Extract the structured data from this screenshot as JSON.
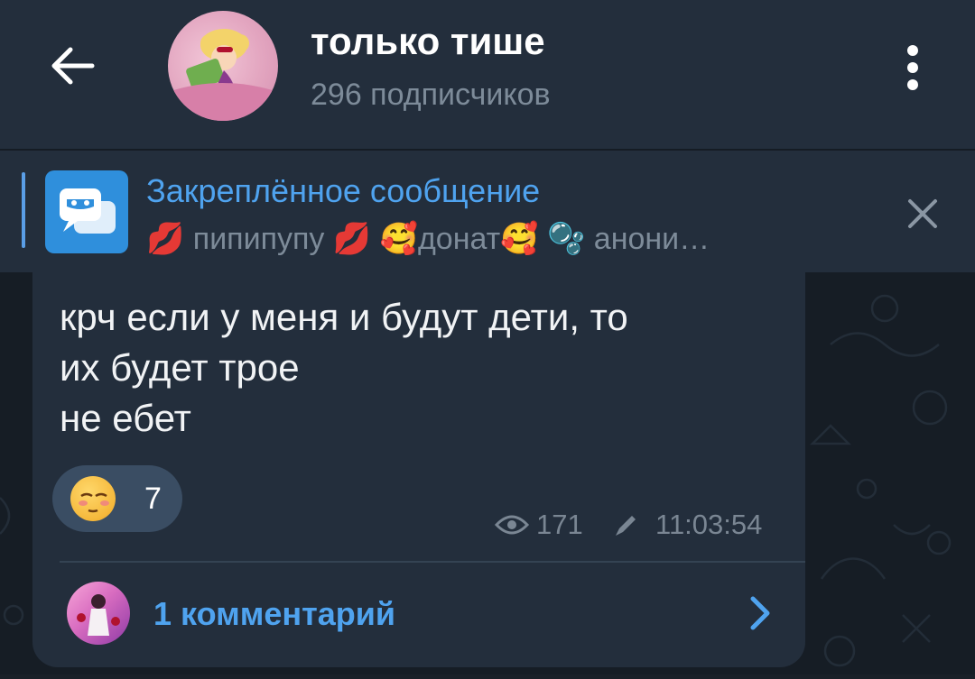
{
  "header": {
    "title": "только тише",
    "subtitle": "296 подписчиков",
    "back_icon": "arrow-left-icon",
    "menu_icon": "more-vertical-icon"
  },
  "pinned": {
    "title": "Закреплённое сообщение",
    "text": "💋 пипипупу 💋 🥰донат🥰 🫧 анони…",
    "close_icon": "close-icon"
  },
  "message": {
    "text": "крч если у меня и будут дети, то\nих будет трое\nне ебет",
    "reaction": {
      "emoji": "pensive-blush-emoji",
      "count": "7"
    },
    "views": "171",
    "time": "11:03:54"
  },
  "comments": {
    "label": "1 комментарий"
  },
  "colors": {
    "header_bg": "#232e3c",
    "accent": "#4fa3ef",
    "bubble_bg": "#232e3c",
    "chat_bg": "#161d25",
    "muted": "#7d8b99"
  }
}
